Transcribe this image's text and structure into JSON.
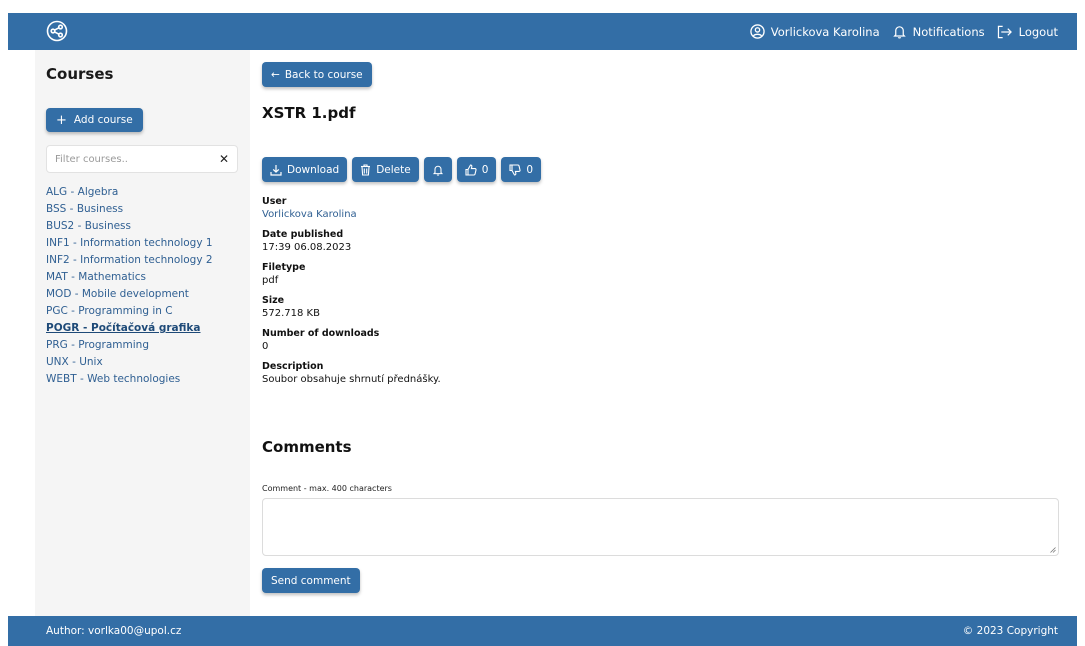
{
  "header": {
    "user_name": "Vorlickova Karolina",
    "notifications_label": "Notifications",
    "logout_label": "Logout"
  },
  "sidebar": {
    "title": "Courses",
    "add_course_label": "Add course",
    "filter_placeholder": "Filter courses..",
    "clear_symbol": "✕",
    "courses": [
      {
        "label": "ALG - Algebra",
        "active": false
      },
      {
        "label": "BSS - Business",
        "active": false
      },
      {
        "label": "BUS2 - Business",
        "active": false
      },
      {
        "label": "INF1 - Information technology 1",
        "active": false
      },
      {
        "label": "INF2 - Information technology 2",
        "active": false
      },
      {
        "label": "MAT - Mathematics",
        "active": false
      },
      {
        "label": "MOD - Mobile development",
        "active": false
      },
      {
        "label": "PGC - Programming in C",
        "active": false
      },
      {
        "label": "POGR - Počítačová grafika",
        "active": true
      },
      {
        "label": "PRG - Programming",
        "active": false
      },
      {
        "label": "UNX - Unix",
        "active": false
      },
      {
        "label": "WEBT - Web technologies",
        "active": false
      }
    ]
  },
  "main": {
    "back_label": "Back to course",
    "back_arrow": "←",
    "file_title": "XSTR 1.pdf",
    "actions": {
      "download_label": "Download",
      "delete_label": "Delete",
      "likes": "0",
      "dislikes": "0"
    },
    "fields": [
      {
        "label": "User",
        "value": "Vorlickova Karolina",
        "link": true
      },
      {
        "label": "Date published",
        "value": "17:39 06.08.2023",
        "link": false
      },
      {
        "label": "Filetype",
        "value": "pdf",
        "link": false
      },
      {
        "label": "Size",
        "value": "572.718 KB",
        "link": false
      },
      {
        "label": "Number of downloads",
        "value": "0",
        "link": false
      },
      {
        "label": "Description",
        "value": "Soubor obsahuje shrnutí přednášky.",
        "link": false
      }
    ],
    "comments_title": "Comments",
    "comment_label": "Comment - max. 400 characters",
    "comment_value": "",
    "send_label": "Send comment"
  },
  "footer": {
    "author": "Author: vorlka00@upol.cz",
    "copyright": "© 2023 Copyright"
  },
  "colors": {
    "primary": "#336ea6",
    "sidebar_bg": "#f5f5f5",
    "link": "#2f5f92"
  }
}
